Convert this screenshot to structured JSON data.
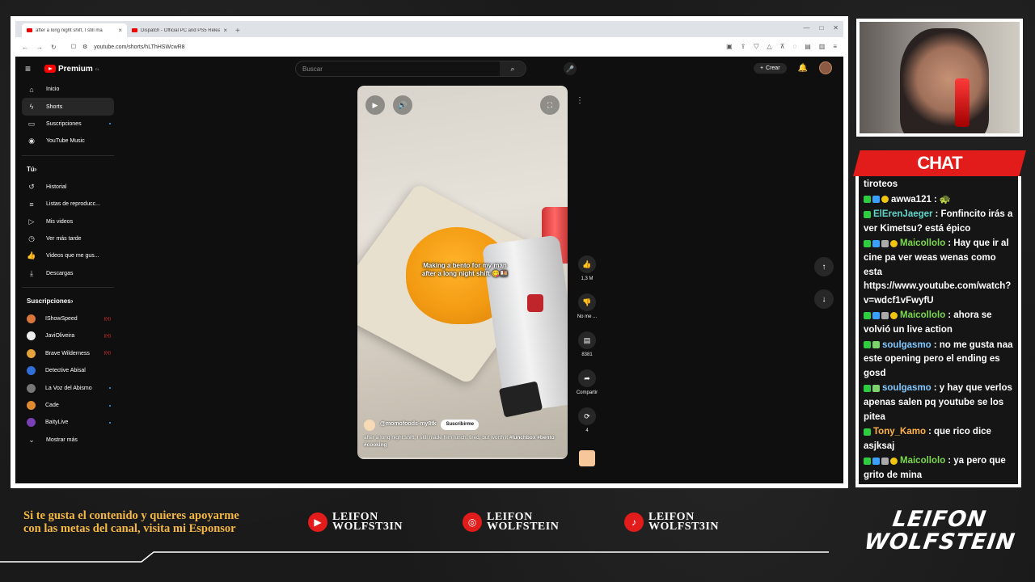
{
  "browser": {
    "tabs": [
      {
        "title": "after a long night shift, I still ma",
        "active": true
      },
      {
        "title": "Dispatch - Official PC and PS5 Relea",
        "active": false
      }
    ],
    "url": "youtube.com/shorts/hLThHSWcwR8"
  },
  "youtube": {
    "logo_text": "Premium",
    "logo_region": "CL",
    "search_placeholder": "Buscar",
    "create_label": "Crear",
    "sidebar_main": [
      {
        "label": "Inicio",
        "icon": "home-icon",
        "glyph": "⌂"
      },
      {
        "label": "Shorts",
        "icon": "shorts-icon",
        "glyph": "ϟ",
        "active": true
      },
      {
        "label": "Suscripciones",
        "icon": "subscriptions-icon",
        "glyph": "▭",
        "dot": true
      },
      {
        "label": "YouTube Music",
        "icon": "music-icon",
        "glyph": "◉"
      }
    ],
    "you_heading": "Tú",
    "sidebar_you": [
      {
        "label": "Historial",
        "icon": "history-icon",
        "glyph": "↺"
      },
      {
        "label": "Listas de reproducc...",
        "icon": "playlists-icon",
        "glyph": "≡"
      },
      {
        "label": "Mis videos",
        "icon": "my-videos-icon",
        "glyph": "▷"
      },
      {
        "label": "Ver más tarde",
        "icon": "watch-later-icon",
        "glyph": "◷"
      },
      {
        "label": "Videos que me gus...",
        "icon": "liked-icon",
        "glyph": "👍"
      },
      {
        "label": "Descargas",
        "icon": "downloads-icon",
        "glyph": "⤓"
      }
    ],
    "subs_heading": "Suscripciones",
    "subscriptions": [
      {
        "label": "IShowSpeed",
        "color": "#d9773a",
        "live": true
      },
      {
        "label": "JaviOliveira",
        "color": "#eeeeee",
        "live": true
      },
      {
        "label": "Brave Wilderness",
        "color": "#e5a23c",
        "live": true
      },
      {
        "label": "Detective Abisal",
        "color": "#2f6fd6",
        "live": false
      },
      {
        "label": "La Voz del Abismo",
        "color": "#777777",
        "dot": true
      },
      {
        "label": "Cade",
        "color": "#e08a30",
        "dot": true
      },
      {
        "label": "BaityLive",
        "color": "#7a3fb5",
        "dot": true
      }
    ],
    "show_more": "Mostrar más",
    "short": {
      "caption_line1": "Making a bento for my man",
      "caption_line2": "after a long night shift 😋🍱",
      "channel": "@momofoods-my8tk",
      "subscribe": "Suscribirme",
      "description": "after a long night shift, I still made him lunch. tired, but worth it",
      "tags": "#lunchbox #bento #cooking",
      "likes": "1,3 M",
      "dislike_label": "No me ...",
      "comments": "8381",
      "share_label": "Compartir",
      "remix_count": "4"
    }
  },
  "chat": {
    "title": "CHAT",
    "messages": [
      {
        "user": "",
        "color": "#ffffff",
        "badges": [],
        "text": "tiroteos"
      },
      {
        "user": "awwa121",
        "color": "#ffffff",
        "badges": [
          "b-green",
          "b-blue",
          "b-gold"
        ],
        "text": ": 🐢"
      },
      {
        "user": "ElErenJaeger",
        "color": "#5fd6c8",
        "badges": [
          "b-green"
        ],
        "text": ": Fonfincito irás a ver Kimetsu? está épico"
      },
      {
        "user": "Maicollolo",
        "color": "#7bd84b",
        "badges": [
          "b-green",
          "b-blue",
          "b-grey",
          "b-gold"
        ],
        "text": ": Hay que ir al cine pa ver weas wenas como esta https://www.youtube.com/watch?v=wdcf1vFwyfU"
      },
      {
        "user": "Maicollolo",
        "color": "#7bd84b",
        "badges": [
          "b-green",
          "b-blue",
          "b-grey",
          "b-gold"
        ],
        "text": ": ahora se volvió un live action"
      },
      {
        "user": "soulgasmo",
        "color": "#7ec8ff",
        "badges": [
          "b-green",
          "b-cross"
        ],
        "text": ": no me gusta naa este opening pero el ending es gosd"
      },
      {
        "user": "soulgasmo",
        "color": "#7ec8ff",
        "badges": [
          "b-green",
          "b-cross"
        ],
        "text": ": y hay que verlos apenas salen pq youtube se los pitea"
      },
      {
        "user": "Tony_Kamo",
        "color": "#ffb347",
        "badges": [
          "b-green"
        ],
        "text": ": que rico dice asjksaj"
      },
      {
        "user": "Maicollolo",
        "color": "#7bd84b",
        "badges": [
          "b-green",
          "b-blue",
          "b-grey",
          "b-gold"
        ],
        "text": ": ya pero que grito de mina"
      }
    ]
  },
  "footer": {
    "promo": "Si te gusta el contenido y quieres apoyarme con las metas del canal, visita mi Esponsor",
    "socials": [
      {
        "platform": "youtube-icon",
        "glyph": "▶",
        "line1": "LEIFON",
        "line2": "WOLFST3IN"
      },
      {
        "platform": "instagram-icon",
        "glyph": "◎",
        "line1": "LEIFON",
        "line2": "WOLFSTEIN"
      },
      {
        "platform": "tiktok-icon",
        "glyph": "♪",
        "line1": "LEIFON",
        "line2": "WOLFST3IN"
      }
    ],
    "brand_line1": "LEIFON",
    "brand_line2": "WOLFSTEIN"
  }
}
